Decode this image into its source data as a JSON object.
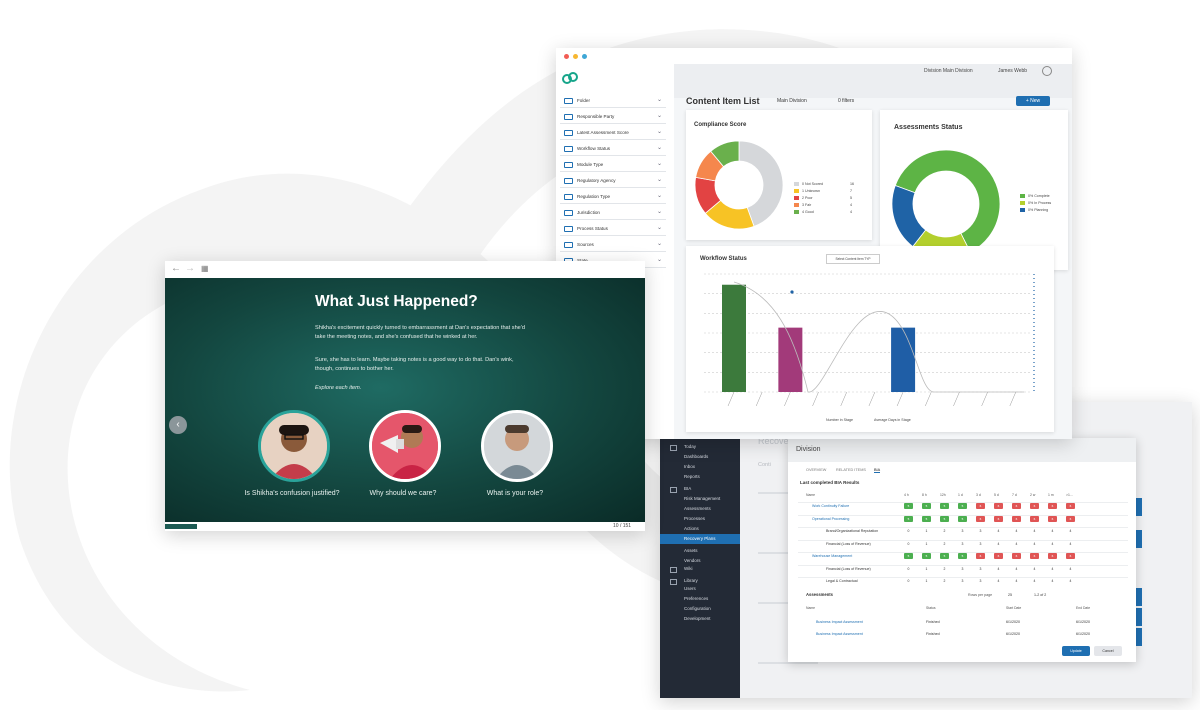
{
  "course": {
    "title": "What Just Happened?",
    "paragraphs": [
      "Shikha's excitement quickly turned to embarrassment at Dan's expectation that she'd take the meeting notes, and she's confused that he winked at her.",
      "Sure, she has to learn. Maybe taking notes is a good way to do that. Dan's wink, though, continues to bother her.",
      "Explore each item."
    ],
    "items": [
      {
        "caption": "Is Shikha's confusion justified?"
      },
      {
        "caption": "Why should we care?"
      },
      {
        "caption": "What is your role?"
      }
    ],
    "page_indicator": "10 / 151",
    "progress": 0.066
  },
  "content": {
    "header": {
      "division": "Division Main Division",
      "user": "James Webb"
    },
    "sidebar_filters": [
      "Folder",
      "Responsible Party",
      "Latest Assessment Score",
      "Workflow Status",
      "Module Type",
      "Regulatory Agency",
      "Regulation Type",
      "Jurisdiction",
      "Process Status",
      "Sources",
      "State"
    ],
    "title": "Content Item List",
    "breadcrumb": "Main Division",
    "filters_label": "0 filters",
    "new_button": "+ New",
    "compliance": {
      "title": "Compliance Score",
      "legend": [
        "0 Not Scored",
        "1 Unknown",
        "2 Poor",
        "3 Fair",
        "4 Good"
      ],
      "legend_values": [
        "16",
        "7",
        "5",
        "4",
        "4"
      ]
    },
    "assessments": {
      "title": "Assessments Status",
      "legend": [
        "0% Complete",
        "0% In Process",
        "0% Planning"
      ]
    },
    "workflow": {
      "title": "Workflow Status",
      "select_label": "Select Content Item TYP",
      "legend": [
        "Number in Stage",
        "Average Days in Stage"
      ]
    }
  },
  "division": {
    "bg_title": "Recove",
    "bg_sub": "Conti",
    "modal_title": "Division",
    "tabs": [
      "OVERVIEW",
      "RELATED ITEMS",
      "BIA"
    ],
    "section_title": "Last completed BIA Results",
    "name_header": "Name",
    "col_headers": [
      "4 h",
      "8 h",
      "12h",
      "1 d",
      "3 d",
      "5 d",
      "7 d",
      "2 w",
      "1 m",
      ">1..."
    ],
    "rows": [
      {
        "name": "Work Continuity Failure",
        "link": true,
        "cells": [
          "g",
          "g",
          "g",
          "g",
          "r",
          "r",
          "r",
          "r",
          "r",
          "r"
        ],
        "values": [
          "5",
          "5",
          "5",
          "5",
          "6",
          "6",
          "6",
          "6",
          "6",
          "6"
        ]
      },
      {
        "name": "Operational Processing",
        "link": true,
        "cells": [
          "g",
          "g",
          "g",
          "g",
          "r",
          "r",
          "r",
          "r",
          "r",
          "r"
        ],
        "values": [
          "5",
          "5",
          "5",
          "5",
          "6",
          "6",
          "6",
          "6",
          "6",
          "6"
        ]
      },
      {
        "name": "Brand/Organizational Reputation",
        "link": false,
        "cells": [],
        "values": [
          "0",
          "1",
          "2",
          "3",
          "3",
          "4",
          "4",
          "4",
          "4",
          "4"
        ]
      },
      {
        "name": "Financial (Loss of Revenue)",
        "link": false,
        "cells": [],
        "values": [
          "0",
          "1",
          "2",
          "3",
          "3",
          "4",
          "4",
          "4",
          "4",
          "4"
        ]
      },
      {
        "name": "Warehouse Management",
        "link": true,
        "cells": [
          "g",
          "g",
          "g",
          "g",
          "r",
          "r",
          "r",
          "r",
          "r",
          "r"
        ],
        "values": [
          "5",
          "5",
          "5",
          "5",
          "6",
          "6",
          "6",
          "6",
          "6",
          "6"
        ]
      },
      {
        "name": "Financial (Loss of Revenue)",
        "link": false,
        "cells": [],
        "values": [
          "0",
          "1",
          "2",
          "3",
          "3",
          "4",
          "4",
          "4",
          "4",
          "4"
        ]
      },
      {
        "name": "Legal & Contractual",
        "link": false,
        "cells": [],
        "values": [
          "0",
          "1",
          "2",
          "3",
          "3",
          "4",
          "4",
          "4",
          "4",
          "4"
        ]
      }
    ],
    "assess_title": "Assessments",
    "rows_per_page": "Rows per page",
    "rows_count": "25",
    "range": "1-2 of 2",
    "assess_headers": [
      "Name",
      "Status",
      "Start Date",
      "End Date"
    ],
    "assess_rows": [
      {
        "name": "Business Impact Assessment",
        "status": "Finished",
        "start": "6/1/2020",
        "end": "6/1/2020"
      },
      {
        "name": "Business Impact Assessment",
        "status": "Finished",
        "start": "6/1/2020",
        "end": "6/1/2020"
      }
    ],
    "update_button": "Update",
    "cancel_button": "Cancel",
    "nav": [
      "Today",
      "Dashboards",
      "Inbox",
      "Reports",
      "BIA",
      "Risk Management",
      "Assessments",
      "Processes",
      "Actions",
      "Recovery Plans",
      "Assets",
      "Vendors",
      "Wiki",
      "Library",
      "Users",
      "Preferences",
      "Configuration",
      "Development"
    ]
  },
  "chart_data": [
    {
      "type": "pie",
      "title": "Compliance Score",
      "categories": [
        "0 Not Scored",
        "1 Unknown",
        "2 Poor",
        "3 Fair",
        "4 Good"
      ],
      "values": [
        16,
        7,
        5,
        4,
        4
      ],
      "colors": [
        "#d5d7da",
        "#f7c325",
        "#e24343",
        "#f5874d",
        "#6ab04c"
      ]
    },
    {
      "type": "pie",
      "title": "Assessments Status",
      "categories": [
        "0% Complete",
        "0% In Process",
        "0% Planning"
      ],
      "values": [
        62,
        18,
        20
      ],
      "colors": [
        "#5db445",
        "#b3cf2d",
        "#1f63a6"
      ]
    },
    {
      "type": "bar",
      "title": "Workflow Status",
      "categories": [
        "c1",
        "c2",
        "c3",
        "c4",
        "c5",
        "c6",
        "c7",
        "c8",
        "c9",
        "c10",
        "c11"
      ],
      "values": [
        10,
        0,
        6,
        0,
        0,
        0,
        6,
        0,
        0,
        0,
        0
      ],
      "colors": [
        "#3c7a3c",
        "#3c7a3c",
        "#a23a7a",
        "#a23a7a",
        "#a23a7a",
        "#a23a7a",
        "#1f5ea6",
        "#1f5ea6",
        "#1f5ea6",
        "#1f5ea6",
        "#1f5ea6"
      ],
      "ylim": [
        0,
        11
      ],
      "series": [
        {
          "values": [
            10,
            0,
            6,
            0,
            0,
            0,
            6,
            0,
            0,
            0,
            0
          ]
        }
      ]
    }
  ]
}
